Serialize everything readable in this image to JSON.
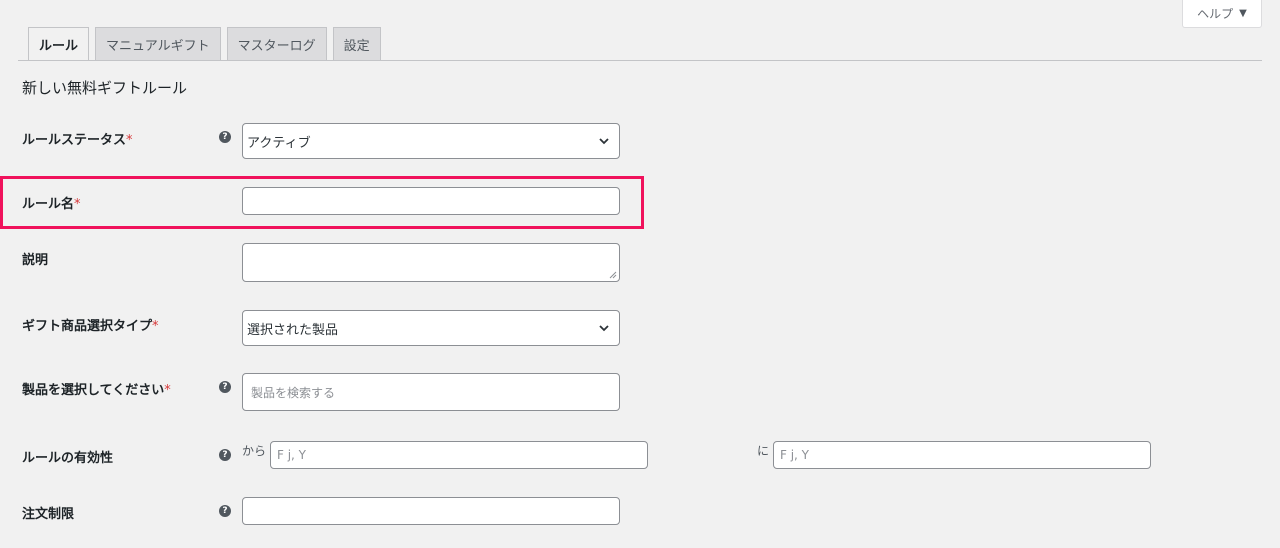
{
  "help": {
    "label": "ヘルプ",
    "caret": "▼"
  },
  "tabs": [
    {
      "label": "ルール"
    },
    {
      "label": "マニュアルギフト"
    },
    {
      "label": "マスターログ"
    },
    {
      "label": "設定"
    }
  ],
  "section_title": "新しい無料ギフトルール",
  "fields": {
    "status": {
      "label": "ルールステータス",
      "required": "*",
      "value": "アクティブ"
    },
    "name": {
      "label": "ルール名",
      "required": "*",
      "value": ""
    },
    "description": {
      "label": "説明",
      "value": ""
    },
    "gift_type": {
      "label": "ギフト商品選択タイプ",
      "required": "*",
      "value": "選択された製品"
    },
    "products": {
      "label": "製品を選択してください",
      "required": "*",
      "placeholder": "製品を検索する"
    },
    "validity": {
      "label": "ルールの有効性",
      "from_label": "から",
      "to_label": "に",
      "from_placeholder": "F j, Y",
      "to_placeholder": "F j, Y"
    },
    "order_limit": {
      "label": "注文制限",
      "value": ""
    }
  },
  "help_icon_glyph": "?",
  "colors": {
    "highlight": "#f0125c",
    "required": "#d63638"
  }
}
